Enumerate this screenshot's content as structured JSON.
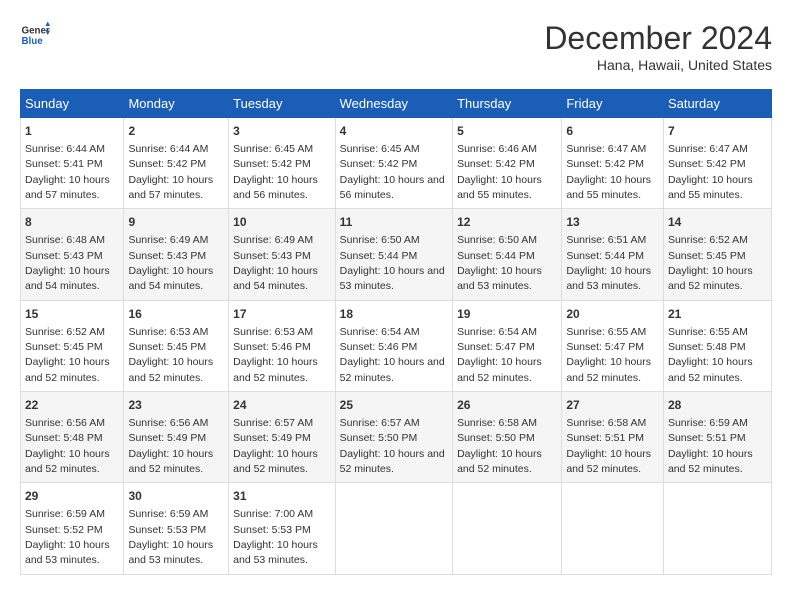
{
  "header": {
    "logo_general": "General",
    "logo_blue": "Blue",
    "month_title": "December 2024",
    "location": "Hana, Hawaii, United States"
  },
  "days_of_week": [
    "Sunday",
    "Monday",
    "Tuesday",
    "Wednesday",
    "Thursday",
    "Friday",
    "Saturday"
  ],
  "weeks": [
    [
      {
        "day": "1",
        "sunrise": "6:44 AM",
        "sunset": "5:41 PM",
        "daylight": "10 hours and 57 minutes."
      },
      {
        "day": "2",
        "sunrise": "6:44 AM",
        "sunset": "5:42 PM",
        "daylight": "10 hours and 57 minutes."
      },
      {
        "day": "3",
        "sunrise": "6:45 AM",
        "sunset": "5:42 PM",
        "daylight": "10 hours and 56 minutes."
      },
      {
        "day": "4",
        "sunrise": "6:45 AM",
        "sunset": "5:42 PM",
        "daylight": "10 hours and 56 minutes."
      },
      {
        "day": "5",
        "sunrise": "6:46 AM",
        "sunset": "5:42 PM",
        "daylight": "10 hours and 55 minutes."
      },
      {
        "day": "6",
        "sunrise": "6:47 AM",
        "sunset": "5:42 PM",
        "daylight": "10 hours and 55 minutes."
      },
      {
        "day": "7",
        "sunrise": "6:47 AM",
        "sunset": "5:42 PM",
        "daylight": "10 hours and 55 minutes."
      }
    ],
    [
      {
        "day": "8",
        "sunrise": "6:48 AM",
        "sunset": "5:43 PM",
        "daylight": "10 hours and 54 minutes."
      },
      {
        "day": "9",
        "sunrise": "6:49 AM",
        "sunset": "5:43 PM",
        "daylight": "10 hours and 54 minutes."
      },
      {
        "day": "10",
        "sunrise": "6:49 AM",
        "sunset": "5:43 PM",
        "daylight": "10 hours and 54 minutes."
      },
      {
        "day": "11",
        "sunrise": "6:50 AM",
        "sunset": "5:44 PM",
        "daylight": "10 hours and 53 minutes."
      },
      {
        "day": "12",
        "sunrise": "6:50 AM",
        "sunset": "5:44 PM",
        "daylight": "10 hours and 53 minutes."
      },
      {
        "day": "13",
        "sunrise": "6:51 AM",
        "sunset": "5:44 PM",
        "daylight": "10 hours and 53 minutes."
      },
      {
        "day": "14",
        "sunrise": "6:52 AM",
        "sunset": "5:45 PM",
        "daylight": "10 hours and 52 minutes."
      }
    ],
    [
      {
        "day": "15",
        "sunrise": "6:52 AM",
        "sunset": "5:45 PM",
        "daylight": "10 hours and 52 minutes."
      },
      {
        "day": "16",
        "sunrise": "6:53 AM",
        "sunset": "5:45 PM",
        "daylight": "10 hours and 52 minutes."
      },
      {
        "day": "17",
        "sunrise": "6:53 AM",
        "sunset": "5:46 PM",
        "daylight": "10 hours and 52 minutes."
      },
      {
        "day": "18",
        "sunrise": "6:54 AM",
        "sunset": "5:46 PM",
        "daylight": "10 hours and 52 minutes."
      },
      {
        "day": "19",
        "sunrise": "6:54 AM",
        "sunset": "5:47 PM",
        "daylight": "10 hours and 52 minutes."
      },
      {
        "day": "20",
        "sunrise": "6:55 AM",
        "sunset": "5:47 PM",
        "daylight": "10 hours and 52 minutes."
      },
      {
        "day": "21",
        "sunrise": "6:55 AM",
        "sunset": "5:48 PM",
        "daylight": "10 hours and 52 minutes."
      }
    ],
    [
      {
        "day": "22",
        "sunrise": "6:56 AM",
        "sunset": "5:48 PM",
        "daylight": "10 hours and 52 minutes."
      },
      {
        "day": "23",
        "sunrise": "6:56 AM",
        "sunset": "5:49 PM",
        "daylight": "10 hours and 52 minutes."
      },
      {
        "day": "24",
        "sunrise": "6:57 AM",
        "sunset": "5:49 PM",
        "daylight": "10 hours and 52 minutes."
      },
      {
        "day": "25",
        "sunrise": "6:57 AM",
        "sunset": "5:50 PM",
        "daylight": "10 hours and 52 minutes."
      },
      {
        "day": "26",
        "sunrise": "6:58 AM",
        "sunset": "5:50 PM",
        "daylight": "10 hours and 52 minutes."
      },
      {
        "day": "27",
        "sunrise": "6:58 AM",
        "sunset": "5:51 PM",
        "daylight": "10 hours and 52 minutes."
      },
      {
        "day": "28",
        "sunrise": "6:59 AM",
        "sunset": "5:51 PM",
        "daylight": "10 hours and 52 minutes."
      }
    ],
    [
      {
        "day": "29",
        "sunrise": "6:59 AM",
        "sunset": "5:52 PM",
        "daylight": "10 hours and 53 minutes."
      },
      {
        "day": "30",
        "sunrise": "6:59 AM",
        "sunset": "5:53 PM",
        "daylight": "10 hours and 53 minutes."
      },
      {
        "day": "31",
        "sunrise": "7:00 AM",
        "sunset": "5:53 PM",
        "daylight": "10 hours and 53 minutes."
      },
      {
        "day": "",
        "sunrise": "",
        "sunset": "",
        "daylight": ""
      },
      {
        "day": "",
        "sunrise": "",
        "sunset": "",
        "daylight": ""
      },
      {
        "day": "",
        "sunrise": "",
        "sunset": "",
        "daylight": ""
      },
      {
        "day": "",
        "sunrise": "",
        "sunset": "",
        "daylight": ""
      }
    ]
  ]
}
